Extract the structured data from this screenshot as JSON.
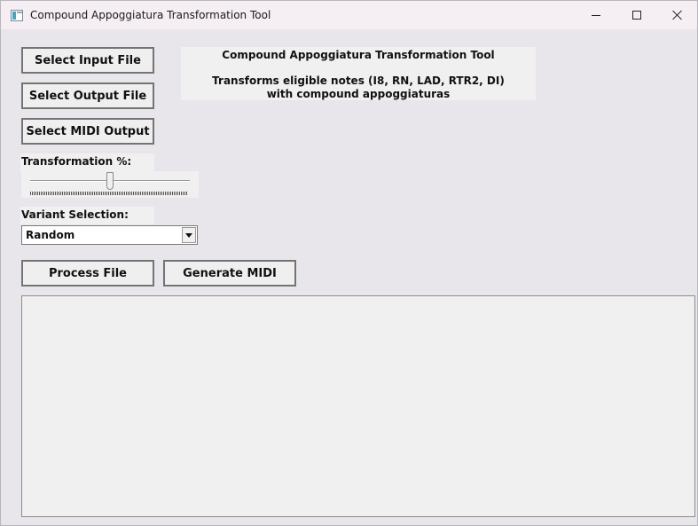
{
  "window": {
    "title": "Compound Appoggiatura Transformation Tool"
  },
  "buttons": {
    "select_input": "Select Input File",
    "select_output": "Select Output File",
    "select_midi_output": "Select MIDI Output",
    "process": "Process File",
    "generate_midi": "Generate MIDI"
  },
  "info": {
    "title": "Compound Appoggiatura Transformation Tool",
    "description": "Transforms eligible notes (I8, RN, LAD, RTR2, DI) with compound appoggiaturas"
  },
  "transformation": {
    "label": "Transformation %:",
    "value_percent": 50
  },
  "variant": {
    "label": "Variant Selection:",
    "selected": "Random"
  },
  "output": {
    "text": ""
  },
  "icons": {
    "app": "app-window-icon",
    "minimize": "minimize-icon",
    "maximize": "maximize-icon",
    "close": "close-icon",
    "dropdown": "chevron-down-icon"
  }
}
